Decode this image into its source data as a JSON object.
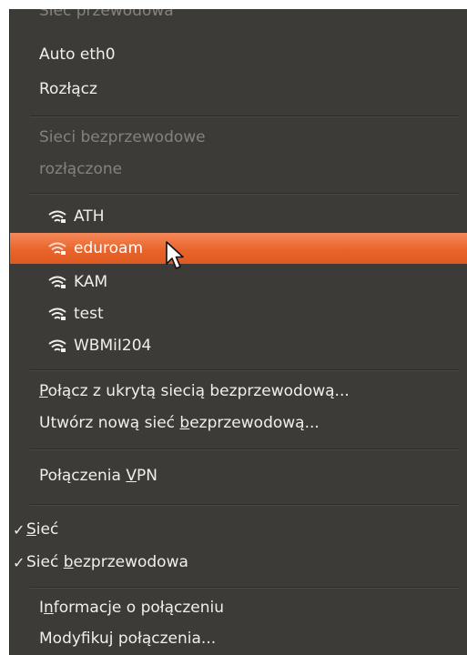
{
  "menu": {
    "wired_header": "Sieć przewodowa",
    "wired_items": [
      {
        "label": "Auto eth0"
      },
      {
        "label": "Rozłącz"
      }
    ],
    "wireless_header": "Sieci bezprzewodowe",
    "wireless_status": "rozłączone",
    "networks": [
      {
        "name": "ATH",
        "icon": "wifi-signal-icon"
      },
      {
        "name": "eduroam",
        "icon": "wifi-signal-icon",
        "highlighted": true
      },
      {
        "name": "KAM",
        "icon": "wifi-signal-icon"
      },
      {
        "name": "test",
        "icon": "wifi-signal-icon"
      },
      {
        "name": "WBMiI204",
        "icon": "wifi-signal-icon"
      }
    ],
    "hidden_network": {
      "pre": "",
      "mnemonic": "P",
      "post": "ołącz z ukrytą siecią bezprzewodową..."
    },
    "new_network": {
      "pre": "Utwórz nową sieć ",
      "mnemonic": "b",
      "post": "ezprzewodową..."
    },
    "vpn": {
      "pre": "Połączenia ",
      "mnemonic": "V",
      "post": "PN"
    },
    "toggle_network": {
      "pre": "",
      "mnemonic": "S",
      "post": "ieć",
      "checked": true
    },
    "toggle_wireless": {
      "pre": "Sieć ",
      "mnemonic": "b",
      "post": "ezprzewodowa",
      "checked": true
    },
    "info": {
      "pre": "I",
      "mnemonic": "n",
      "post": "formacje o połączeniu"
    },
    "edit": {
      "label": "Modyfikuj połączenia..."
    },
    "check_glyph": "✓"
  },
  "colors": {
    "menu_bg": "#3d3b37",
    "text": "#f1efe9",
    "disabled_text": "#85827b",
    "highlight": "#e9642b"
  }
}
